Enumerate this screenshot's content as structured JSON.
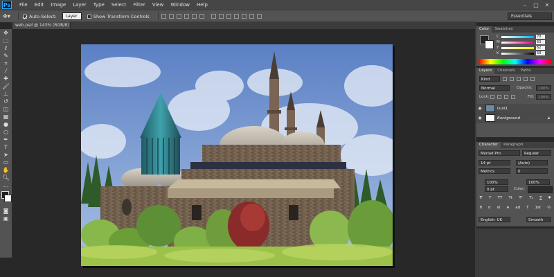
{
  "app": {
    "logo": "Ps"
  },
  "menu": [
    "File",
    "Edit",
    "Image",
    "Layer",
    "Type",
    "Select",
    "Filter",
    "View",
    "Window",
    "Help"
  ],
  "window_controls": [
    "–",
    "□",
    "✕"
  ],
  "options_bar": {
    "auto_select_label": "Auto-Select:",
    "auto_select_value": "Layer",
    "transform_label": "Show Transform Controls",
    "workspace": "Essentials"
  },
  "document": {
    "tab_label": "web.psd @ 143% (RGB/8) *"
  },
  "color_panel": {
    "tabs": [
      "Color",
      "Swatches"
    ],
    "sliders": [
      {
        "label": "C",
        "value": "70"
      },
      {
        "label": "M",
        "value": "63"
      },
      {
        "label": "Y",
        "value": "62"
      },
      {
        "label": "K",
        "value": "58"
      }
    ]
  },
  "layers_panel": {
    "tabs": [
      "Layers",
      "Channels",
      "Paths"
    ],
    "filter_kind": "Kind",
    "blend_mode": "Normal",
    "opacity_label": "Opacity:",
    "opacity_value": "100%",
    "lock_label": "Lock:",
    "fill_label": "Fill:",
    "fill_value": "100%",
    "layers": [
      {
        "name": "ilust1"
      },
      {
        "name": "Background"
      }
    ]
  },
  "character_panel": {
    "tabs": [
      "Character",
      "Paragraph"
    ],
    "font_family": "Myriad Pro",
    "font_style": "Regular",
    "font_size": "14 pt",
    "leading": "(Auto)",
    "kerning": "Metrics",
    "tracking": "0",
    "vertical_scale": "100%",
    "horizontal_scale": "100%",
    "baseline_shift": "0 pt",
    "color_label": "Color:",
    "language": "English: UK",
    "antialias": "Smooth",
    "style_buttons": [
      "T",
      "T",
      "TT",
      "Tt",
      "T¹",
      "T₁",
      "T",
      "T"
    ],
    "opentype_buttons": [
      "fi",
      "σ",
      "st",
      "A",
      "ad",
      "T",
      "1st",
      "½"
    ]
  }
}
